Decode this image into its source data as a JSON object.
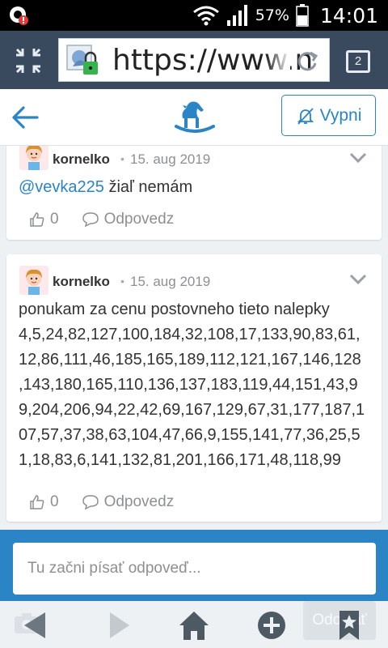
{
  "status_bar": {
    "battery": "57%",
    "time": "14:01"
  },
  "browser": {
    "url": "https://www.n",
    "tab_count": "2"
  },
  "app_header": {
    "mute_label": "Vypni"
  },
  "comments": [
    {
      "author": "kornelko",
      "separator": "•",
      "date": "15. aug 2019",
      "mention": "@vevka225",
      "text": " žiaľ nemám",
      "likes": "0",
      "reply_label": "Odpovedz"
    },
    {
      "author": "kornelko",
      "separator": "•",
      "date": "15. aug 2019",
      "lines": [
        "ponukam za cenu postovneho tieto nalepky",
        "4,5,24,82,127,100,184,32,108,17,133,90,83,61,",
        "12,86,111,46,185,165,189,112,121,167,146,128",
        ",143,180,165,110,136,137,183,119,44,151,43,9",
        "9,204,206,94,22,42,69,167,129,67,31,177,187,1",
        "07,57,37,38,63,104,47,66,9,155,141,77,36,25,5",
        "1,18,83,6,141,132,81,201,166,171,48,118,99"
      ],
      "likes": "0",
      "reply_label": "Odpovedz"
    }
  ],
  "composer": {
    "placeholder": "Tu začni písať odpoveď..."
  },
  "send_button": {
    "label": "Odoslať"
  },
  "colors": {
    "accent": "#2a84c6",
    "browser_bar": "#3a4a5e",
    "background": "#eef1f4"
  }
}
